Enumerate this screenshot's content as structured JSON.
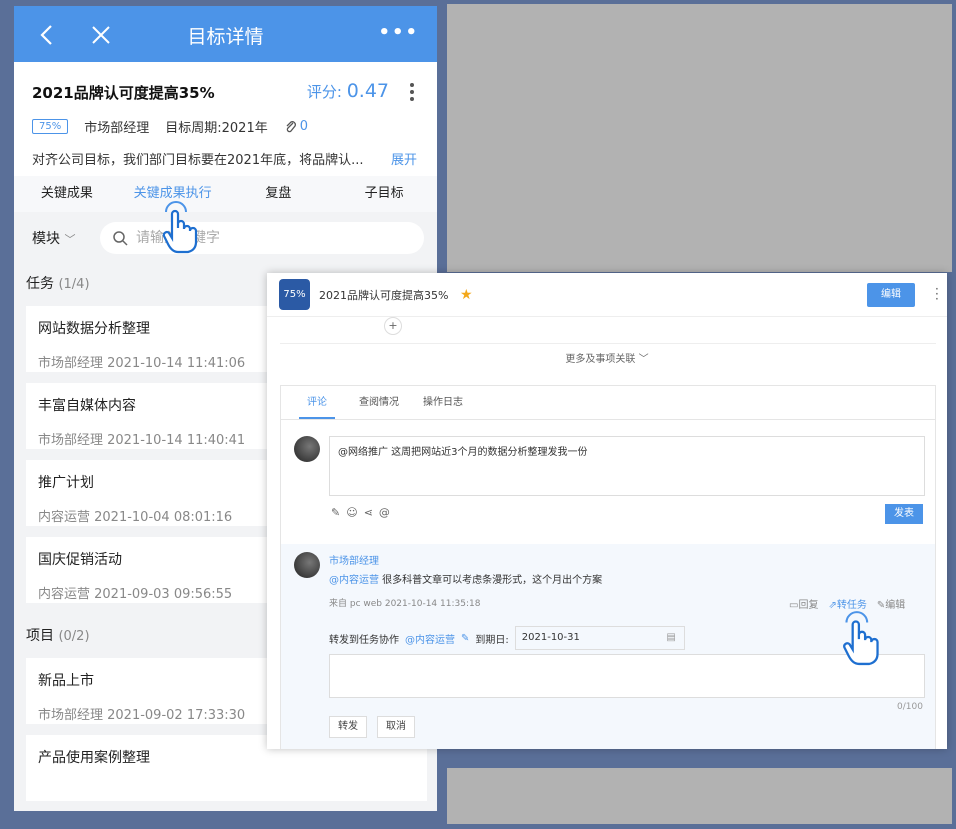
{
  "mobile": {
    "header_title": "目标详情",
    "goal_title": "2021品牌认可度提高35%",
    "score_label": "评分:",
    "score_value": "0.47",
    "progress": "75%",
    "owner": "市场部经理",
    "period": "目标周期:2021年",
    "attachments": "0",
    "description": "对齐公司目标，我们部门目标要在2021年底，将品牌认...",
    "expand": "展开",
    "tabs": [
      "关键成果",
      "关键成果执行",
      "复盘",
      "子目标"
    ],
    "module": "模块",
    "search_placeholder": "请输入关键字",
    "tasks_heading": "任务",
    "tasks_count": "(1/4)",
    "tasks": [
      {
        "name": "网站数据分析整理",
        "meta": "市场部经理  2021-10-14 11:41:06"
      },
      {
        "name": "丰富自媒体内容",
        "meta": "市场部经理  2021-10-14 11:40:41"
      },
      {
        "name": "推广计划",
        "meta": "内容运营  2021-10-04 08:01:16"
      },
      {
        "name": "国庆促销活动",
        "meta": "内容运营  2021-09-03 09:56:55"
      }
    ],
    "projects_heading": "项目",
    "projects_count": "(0/2)",
    "projects": [
      {
        "name": "新品上市",
        "meta": "市场部经理  2021-09-02 17:33:30"
      },
      {
        "name": "产品使用案例整理",
        "meta": ""
      }
    ]
  },
  "desktop": {
    "logo_text": "75%",
    "title": "2021品牌认可度提高35%",
    "edit": "编辑",
    "more_links": "更多及事项关联",
    "tabs": [
      "评论",
      "查阅情况",
      "操作日志"
    ],
    "comment_input": "@网络推广 这周把网站近3个月的数据分析整理发我一份",
    "publish": "发表",
    "comment": {
      "author": "市场部经理",
      "mention": "@内容运营",
      "text": " 很多科普文章可以考虑条漫形式，这个月出个方案",
      "from": "来自 pc web 2021-10-14 11:35:18",
      "reply": "回复",
      "to_task": "转任务",
      "edit": "编辑"
    },
    "forward_label": "转发到任务协作",
    "forward_to": "@内容运营",
    "due_label": "到期日:",
    "due_date": "2021-10-31",
    "char_count": "0/100",
    "forward_btn": "转发",
    "cancel_btn": "取消"
  },
  "colors": {
    "primary": "#4c94e8",
    "background": "#5a6f98"
  }
}
